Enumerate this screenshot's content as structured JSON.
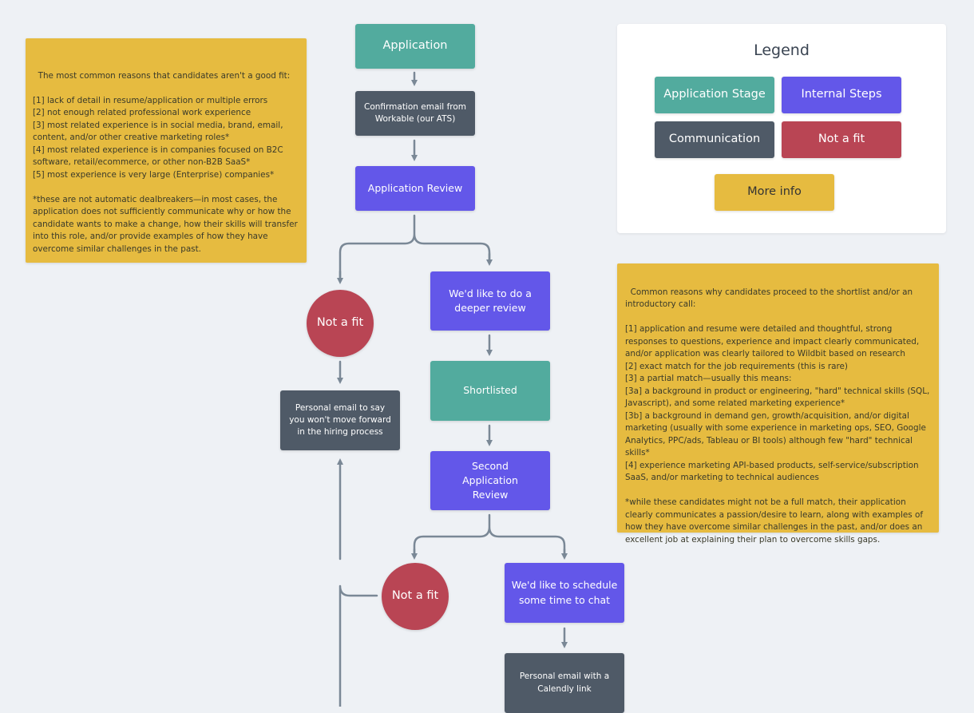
{
  "notes": {
    "not_fit_reasons": {
      "text": "The most common reasons that candidates aren't a good fit:\n\n[1] lack of detail in resume/application or multiple errors\n[2] not enough related professional work experience\n[3] most related experience is in social media, brand, email, content, and/or other creative marketing roles*\n[4] most related experience is in companies focused on B2C software, retail/ecommerce, or other non-B2B SaaS*\n[5] most experience is very large (Enterprise) companies*\n\n*these are not automatic dealbreakers—in most cases, the application does not sufficiently communicate why or how the candidate wants to make a change, how their skills will transfer into this role, and/or provide examples of how they have overcome similar challenges in the past."
    },
    "proceed_reasons": {
      "text": "Common reasons why candidates proceed to the shortlist and/or an introductory call:\n\n[1] application and resume were detailed and thoughtful, strong responses to questions, experience and impact clearly communicated, and/or application was clearly tailored to Wildbit based on research\n[2] exact match for the job requirements (this is rare)\n[3] a partial match—usually this means:\n[3a] a background in product or engineering, \"hard\" technical skills (SQL, Javascript), and some related marketing experience*\n[3b] a background in demand gen, growth/acquisition, and/or digital marketing (usually with some experience in marketing ops, SEO, Google Analytics, PPC/ads, Tableau or BI tools) although few \"hard\" technical skills*\n[4] experience marketing API-based products, self-service/subscription SaaS, and/or marketing to technical audiences\n\n*while these candidates might not be a full match, their application clearly communicates a passion/desire to learn, along with examples of how they have overcome similar challenges in the past, and/or does an excellent job at explaining their plan to overcome skills gaps."
    }
  },
  "legend": {
    "title": "Legend",
    "items": [
      {
        "label": "Application Stage",
        "color": "#52ab9e"
      },
      {
        "label": "Internal Steps",
        "color": "#6357e9"
      },
      {
        "label": "Communication",
        "color": "#4f5a67"
      },
      {
        "label": "Not a fit",
        "color": "#b94554"
      },
      {
        "label": "More info",
        "color": "#e6bb40"
      }
    ]
  },
  "flow": {
    "application": "Application",
    "confirmation_email": "Confirmation email from Workable (our ATS)",
    "application_review": "Application Review",
    "not_fit_1": "Not a fit",
    "deeper_review": "We'd like to do a deeper review",
    "personal_email_reject": "Personal email to say you won't move forward in the hiring process",
    "shortlisted": "Shortlisted",
    "second_review": "Second Application Review",
    "not_fit_2": "Not a fit",
    "schedule_chat": "We'd like to schedule some time to chat",
    "calendly_email": "Personal email with a Calendly link"
  },
  "colors": {
    "background": "#eef1f5",
    "connector": "#7a8896"
  }
}
